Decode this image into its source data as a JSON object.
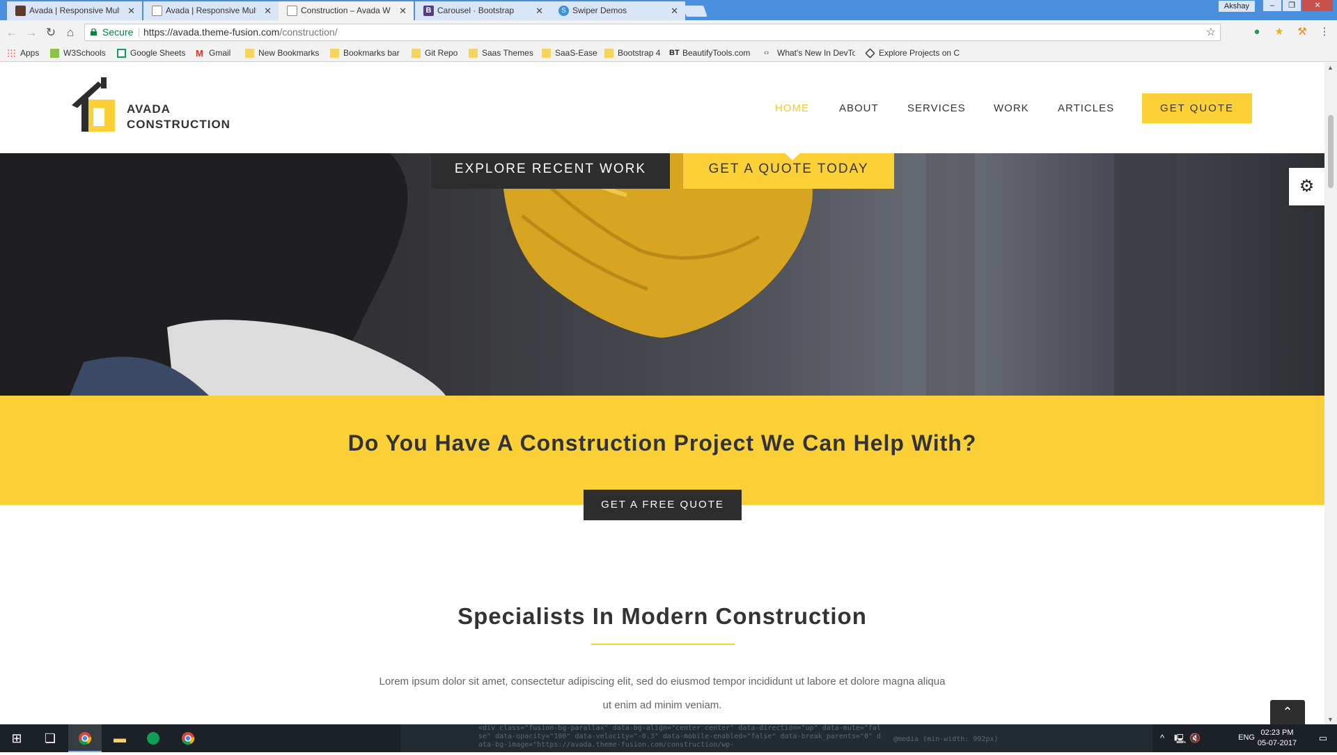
{
  "browser": {
    "tabs": [
      {
        "title": "Avada | Responsive Multi",
        "favicon_color": "#5a3c2c",
        "active": false
      },
      {
        "title": "Avada | Responsive Mult",
        "favicon_color": "#ffffff",
        "active": false
      },
      {
        "title": "Construction – Avada W",
        "favicon_color": "#ffffff",
        "active": true
      },
      {
        "title": "Carousel · Bootstrap",
        "favicon_color": "#563d7c",
        "active": false
      },
      {
        "title": "Swiper Demos",
        "favicon_color": "#3f8fd6",
        "active": false
      }
    ],
    "tab_close_glyph": "✕",
    "user_name": "Akshay",
    "address": {
      "secure_label": "Secure",
      "url_host": "https://avada.theme-fusion.com",
      "url_path": "/construction/"
    },
    "bookmarks": [
      {
        "label": "Apps",
        "icon": "apps-grid"
      },
      {
        "label": "W3Schools",
        "icon": "w3schools-icon"
      },
      {
        "label": "Google Sheets",
        "icon": "sheets-icon"
      },
      {
        "label": "Gmail",
        "icon": "gmail-icon"
      },
      {
        "label": "New Bookmarks",
        "icon": "folder"
      },
      {
        "label": "Bookmarks bar",
        "icon": "folder"
      },
      {
        "label": "Git Repo",
        "icon": "folder"
      },
      {
        "label": "Saas Themes",
        "icon": "folder"
      },
      {
        "label": "SaaS-Ease",
        "icon": "folder"
      },
      {
        "label": "Bootstrap 4",
        "icon": "folder"
      },
      {
        "label": "BeautifyTools.com",
        "icon": "bt-icon"
      },
      {
        "label": "What's New In DevTo",
        "icon": "devtools-icon"
      },
      {
        "label": "Explore Projects on C",
        "icon": "codepen-icon"
      }
    ]
  },
  "site": {
    "logo": {
      "line1": "AVADA",
      "line2": "CONSTRUCTION"
    },
    "nav": [
      {
        "label": "HOME",
        "active": true
      },
      {
        "label": "ABOUT",
        "active": false
      },
      {
        "label": "SERVICES",
        "active": false
      },
      {
        "label": "WORK",
        "active": false
      },
      {
        "label": "ARTICLES",
        "active": false
      }
    ],
    "nav_cta": "GET QUOTE",
    "hero": {
      "button_primary": "EXPLORE RECENT WORK",
      "button_secondary": "GET A QUOTE TODAY"
    },
    "cta": {
      "heading": "Do You Have A Construction Project We Can Help With?",
      "button": "GET A FREE QUOTE"
    },
    "section": {
      "title": "Specialists In Modern Construction",
      "body": "Lorem ipsum dolor sit amet, consectetur adipiscing elit, sed do eiusmod tempor incididunt ut labore et dolore magna aliqua ut enim ad minim veniam."
    },
    "colors": {
      "accent": "#fcd037",
      "dark": "#2d2d2d",
      "text": "#333333"
    }
  },
  "taskbar": {
    "language": "ENG",
    "time": "02:23 PM",
    "date": "05-07-2017",
    "background_code": "<div class=\"fusion-bg-parallax\" data-bg-align=\"center center\" data-direction=\"up\" data-mute=\"false\" data-opacity=\"100\" data-velocity=\"-0.3\" data-mobile-enabled=\"false\" data-break_parents=\"0\" data-bg-image=\"https://avada.theme-fusion.com/construction/wp-",
    "background_code_right": "@media (min-width: 992px)"
  }
}
